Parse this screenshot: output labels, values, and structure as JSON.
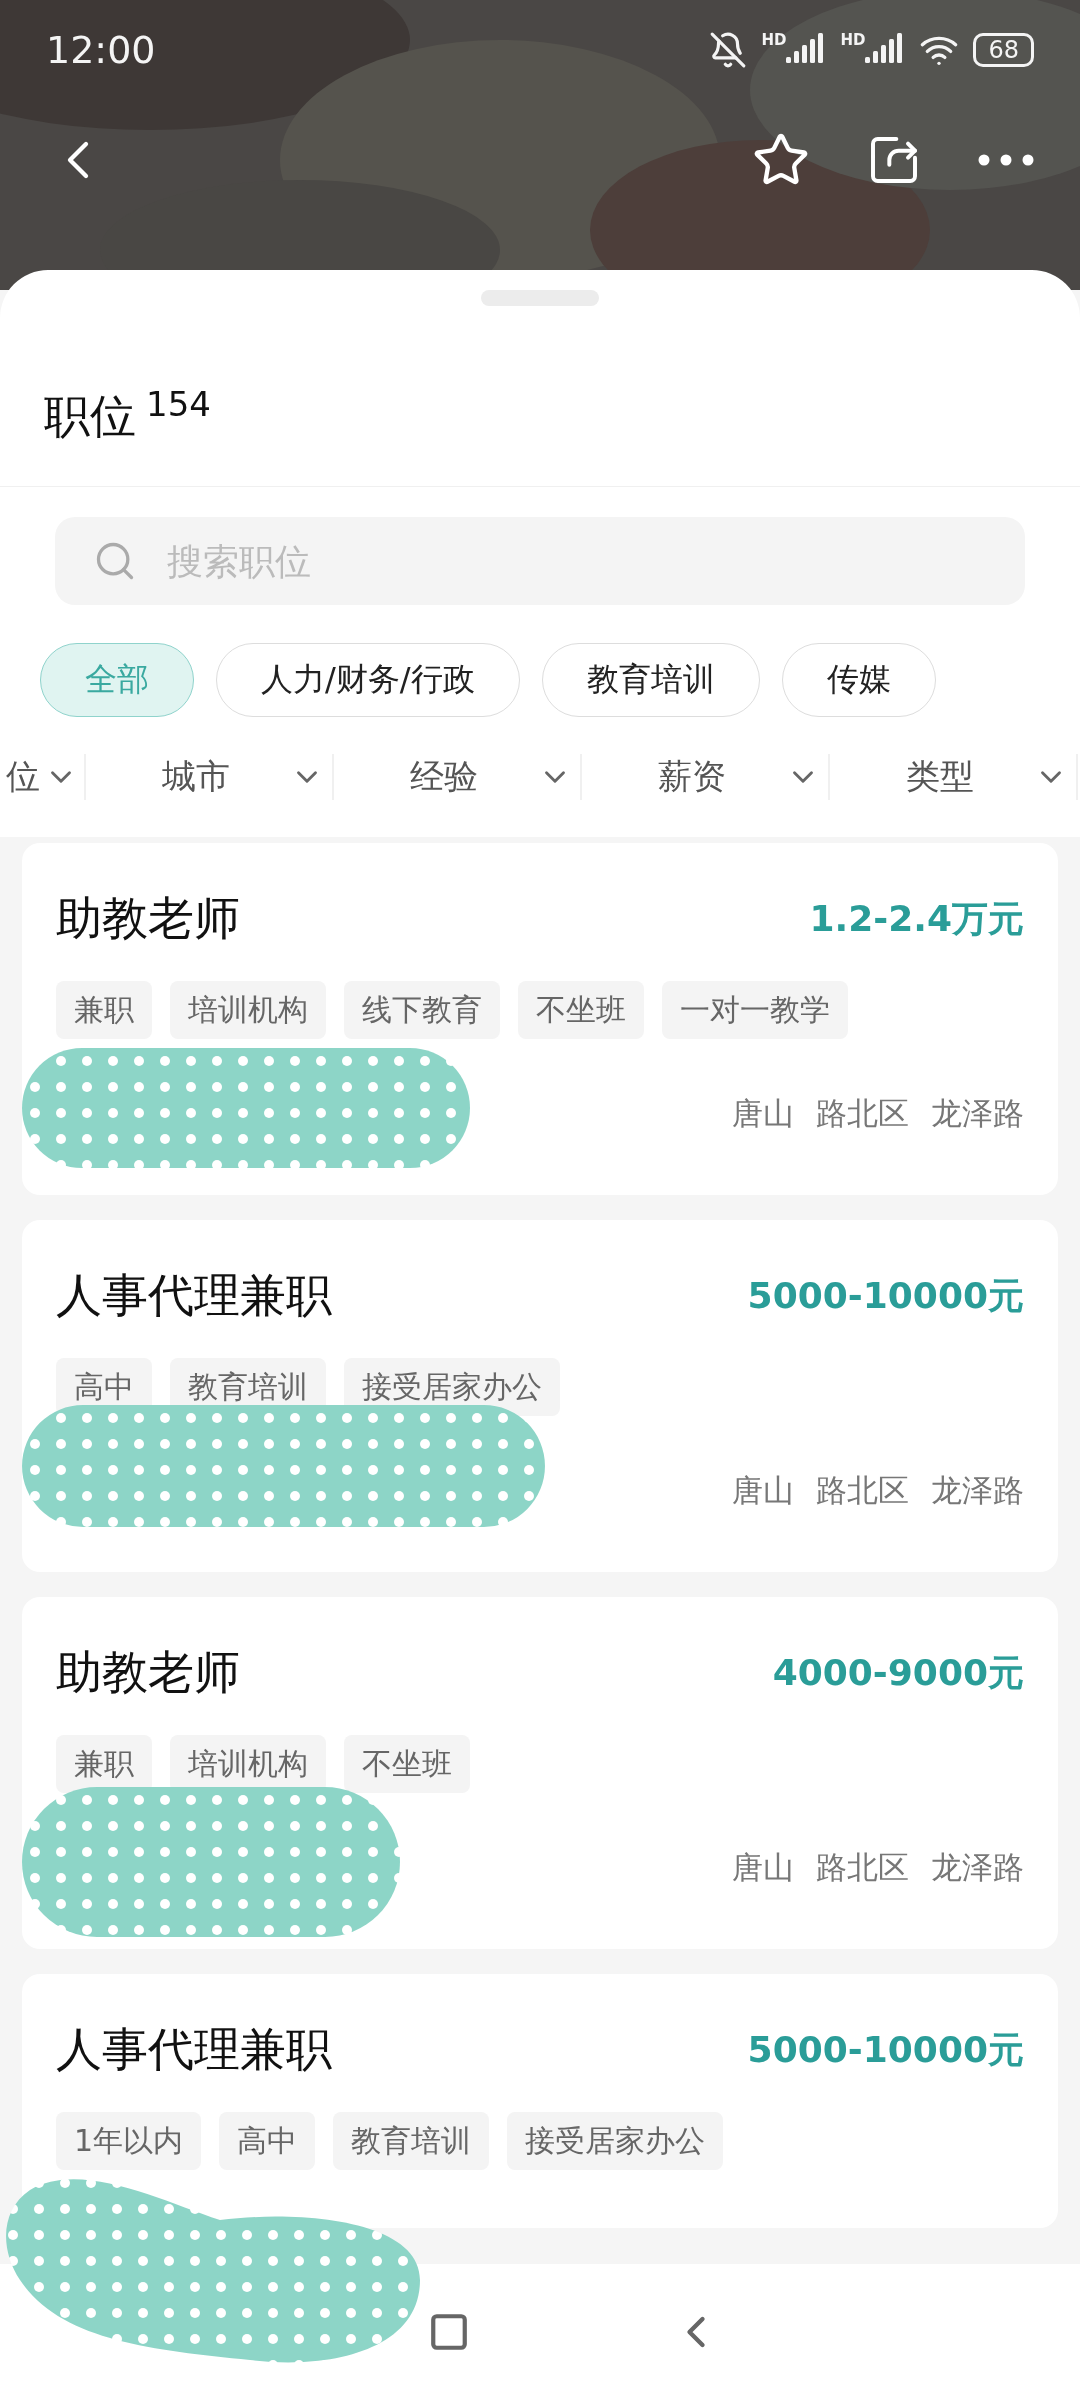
{
  "status_bar": {
    "time": "12:00",
    "sim_labels": [
      "HD",
      "HD"
    ],
    "battery": "68"
  },
  "sheet": {
    "title": "职位",
    "count": "154",
    "search": {
      "placeholder": "搜索职位"
    },
    "categories": [
      {
        "label": "全部",
        "selected": true
      },
      {
        "label": "人力/财务/行政",
        "selected": false
      },
      {
        "label": "教育培训",
        "selected": false
      },
      {
        "label": "传媒",
        "selected": false
      }
    ],
    "filters": [
      "位",
      "城市",
      "经验",
      "薪资",
      "类型"
    ]
  },
  "jobs": [
    {
      "title": "助教老师",
      "salary": "1.2-2.4万元",
      "tags": [
        "兼职",
        "培训机构",
        "线下教育",
        "不坐班",
        "一对一教学"
      ],
      "location": [
        "唐山",
        "路北区",
        "龙泽路"
      ]
    },
    {
      "title": "人事代理兼职",
      "salary": "5000-10000元",
      "tags": [
        "高中",
        "教育培训",
        "接受居家办公"
      ],
      "location": [
        "唐山",
        "路北区",
        "龙泽路"
      ]
    },
    {
      "title": "助教老师",
      "salary": "4000-9000元",
      "tags": [
        "兼职",
        "培训机构",
        "不坐班"
      ],
      "location": [
        "唐山",
        "路北区",
        "龙泽路"
      ]
    },
    {
      "title": "人事代理兼职",
      "salary": "5000-10000元",
      "tags": [
        "1年以内",
        "高中",
        "教育培训",
        "接受居家办公"
      ]
    }
  ]
}
